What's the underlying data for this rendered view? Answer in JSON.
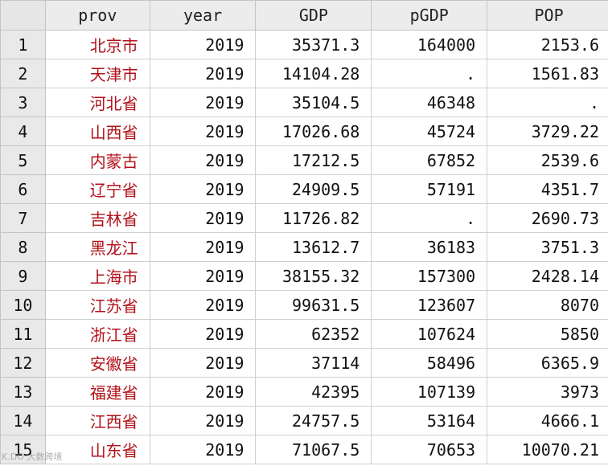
{
  "table": {
    "columns": [
      "prov",
      "year",
      "GDP",
      "pGDP",
      "POP"
    ],
    "rows": [
      {
        "n": "1",
        "prov": "北京市",
        "year": "2019",
        "GDP": "35371.3",
        "pGDP": "164000",
        "POP": "2153.6"
      },
      {
        "n": "2",
        "prov": "天津市",
        "year": "2019",
        "GDP": "14104.28",
        "pGDP": ".",
        "POP": "1561.83"
      },
      {
        "n": "3",
        "prov": "河北省",
        "year": "2019",
        "GDP": "35104.5",
        "pGDP": "46348",
        "POP": "."
      },
      {
        "n": "4",
        "prov": "山西省",
        "year": "2019",
        "GDP": "17026.68",
        "pGDP": "45724",
        "POP": "3729.22"
      },
      {
        "n": "5",
        "prov": "内蒙古",
        "year": "2019",
        "GDP": "17212.5",
        "pGDP": "67852",
        "POP": "2539.6"
      },
      {
        "n": "6",
        "prov": "辽宁省",
        "year": "2019",
        "GDP": "24909.5",
        "pGDP": "57191",
        "POP": "4351.7"
      },
      {
        "n": "7",
        "prov": "吉林省",
        "year": "2019",
        "GDP": "11726.82",
        "pGDP": ".",
        "POP": "2690.73"
      },
      {
        "n": "8",
        "prov": "黑龙江",
        "year": "2019",
        "GDP": "13612.7",
        "pGDP": "36183",
        "POP": "3751.3"
      },
      {
        "n": "9",
        "prov": "上海市",
        "year": "2019",
        "GDP": "38155.32",
        "pGDP": "157300",
        "POP": "2428.14"
      },
      {
        "n": "10",
        "prov": "江苏省",
        "year": "2019",
        "GDP": "99631.5",
        "pGDP": "123607",
        "POP": "8070"
      },
      {
        "n": "11",
        "prov": "浙江省",
        "year": "2019",
        "GDP": "62352",
        "pGDP": "107624",
        "POP": "5850"
      },
      {
        "n": "12",
        "prov": "安徽省",
        "year": "2019",
        "GDP": "37114",
        "pGDP": "58496",
        "POP": "6365.9"
      },
      {
        "n": "13",
        "prov": "福建省",
        "year": "2019",
        "GDP": "42395",
        "pGDP": "107139",
        "POP": "3973"
      },
      {
        "n": "14",
        "prov": "江西省",
        "year": "2019",
        "GDP": "24757.5",
        "pGDP": "53164",
        "POP": "4666.1"
      },
      {
        "n": "15",
        "prov": "山东省",
        "year": "2019",
        "GDP": "71067.5",
        "pGDP": "70653",
        "POP": "10070.21"
      }
    ]
  },
  "watermark": "K.DO 大数跨境",
  "colors": {
    "string_cell": "#b1121a",
    "numeric_cell": "#111111",
    "header_bg": "#ececec",
    "rownum_bg": "#e9e9e9",
    "grid_line": "#cfcfcf"
  }
}
